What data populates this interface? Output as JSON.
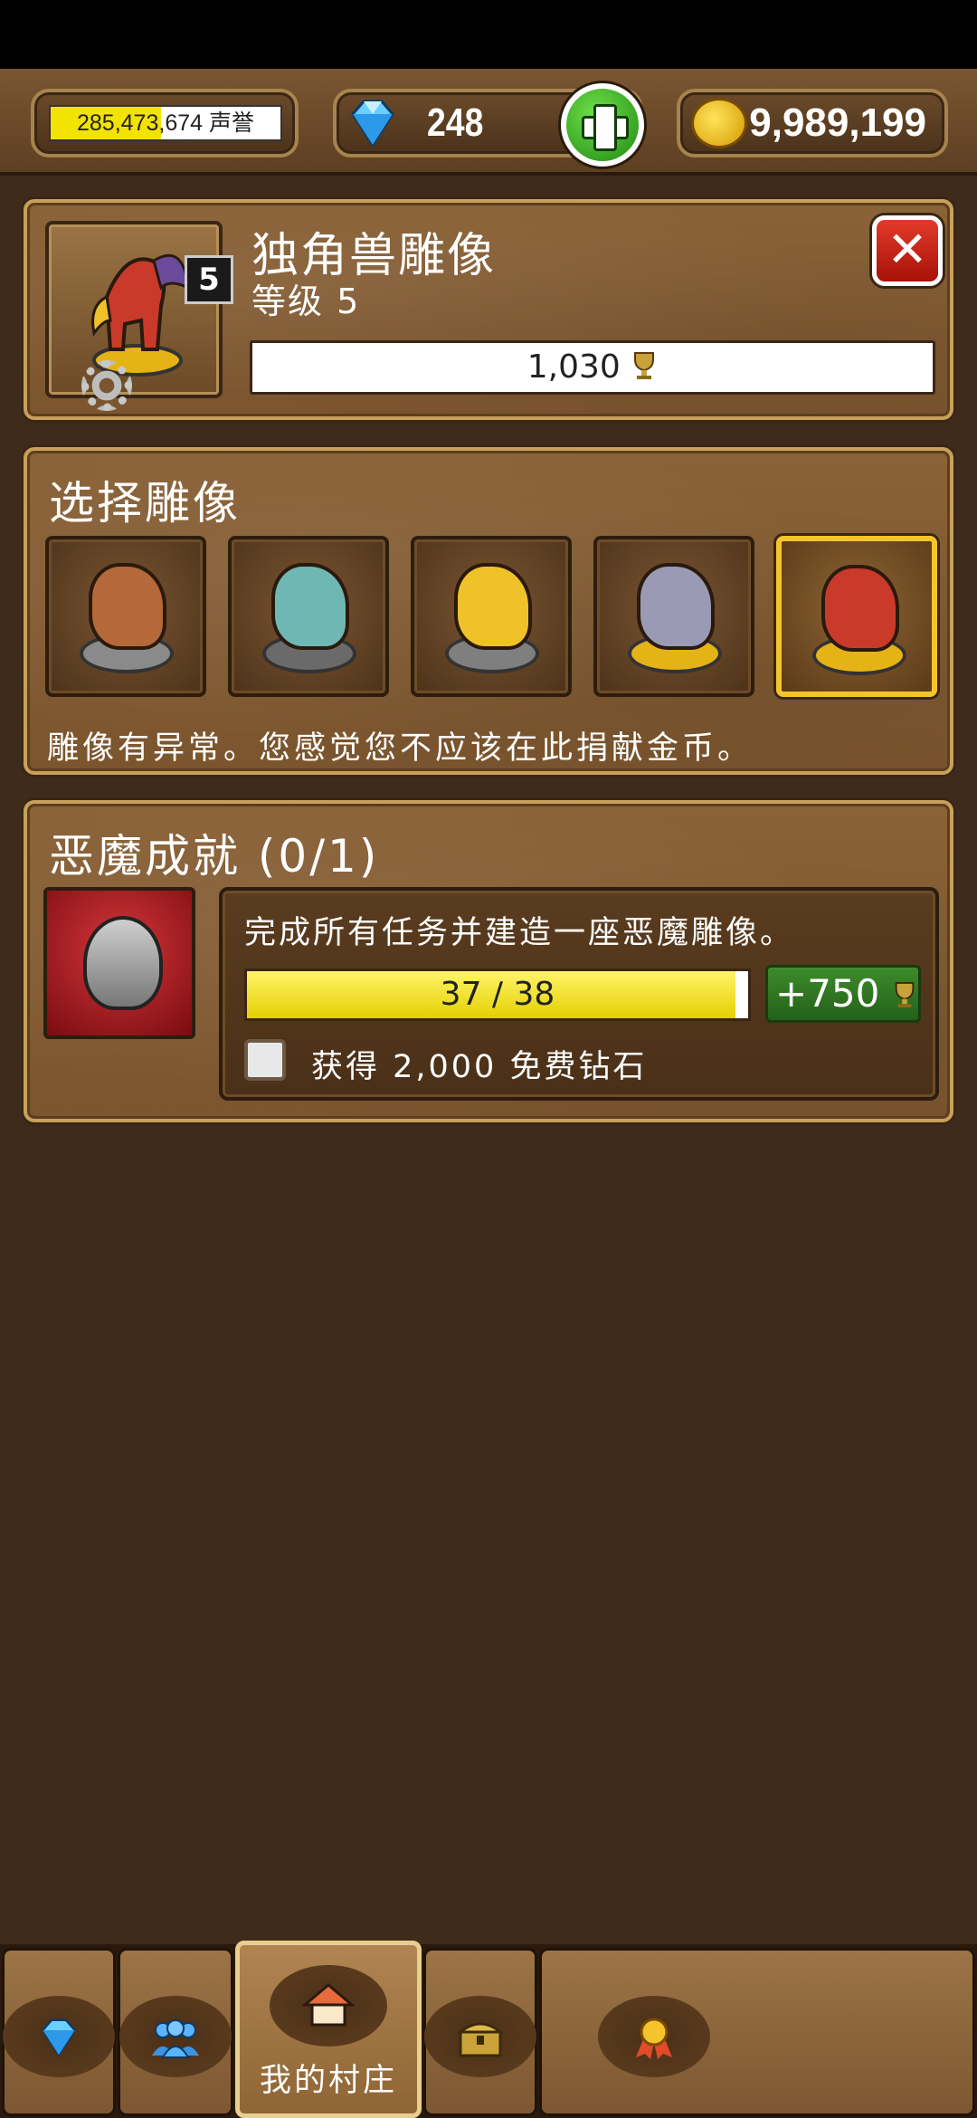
{
  "header": {
    "reputation": {
      "value": "285,473,674 声誉",
      "fill_fraction": 0.48
    },
    "gems": {
      "value": "248"
    },
    "coins": {
      "value": "9,989,199"
    }
  },
  "statue_panel": {
    "title": "独角兽雕像",
    "level_text": "等级 5",
    "level_badge": "5",
    "trophies": "1,030",
    "close_symbol": "✕"
  },
  "select_panel": {
    "title": "选择雕像",
    "statues": [
      {
        "name": "copper",
        "color": "#b5683a",
        "base": "#8a8a8a",
        "selected": false
      },
      {
        "name": "crystal",
        "color": "#6fb7b3",
        "base": "#6a6a6a",
        "selected": false
      },
      {
        "name": "gold",
        "color": "#f0c22a",
        "base": "#7f7f7f",
        "selected": false
      },
      {
        "name": "silver",
        "color": "#9a9ab5",
        "base": "#e6b316",
        "selected": false
      },
      {
        "name": "demon",
        "color": "#c93a2a",
        "base": "#e6b316",
        "selected": true
      }
    ],
    "note": "雕像有异常。您感觉您不应该在此捐献金币。"
  },
  "achievement": {
    "title": "恶魔成就 (0/1)",
    "description": "完成所有任务并建造一座恶魔雕像。",
    "progress_text": "37 / 38",
    "progress_fraction": 0.974,
    "reward": "+750",
    "checkbox_label": "获得 2,000 免费钻石",
    "checked": false
  },
  "nav": {
    "tabs": [
      {
        "id": "gems",
        "icon": "diamond-icon",
        "label": ""
      },
      {
        "id": "friends",
        "icon": "people-icon",
        "label": ""
      },
      {
        "id": "village",
        "icon": "house-icon",
        "label": "我的村庄",
        "active": true
      },
      {
        "id": "chest",
        "icon": "chest-icon",
        "label": ""
      },
      {
        "id": "awards",
        "icon": "medal-icon",
        "label": ""
      }
    ]
  },
  "colors": {
    "accent_gold": "#f5c42a",
    "wood": "#7b552e",
    "reward_green": "#3d8b2a"
  }
}
